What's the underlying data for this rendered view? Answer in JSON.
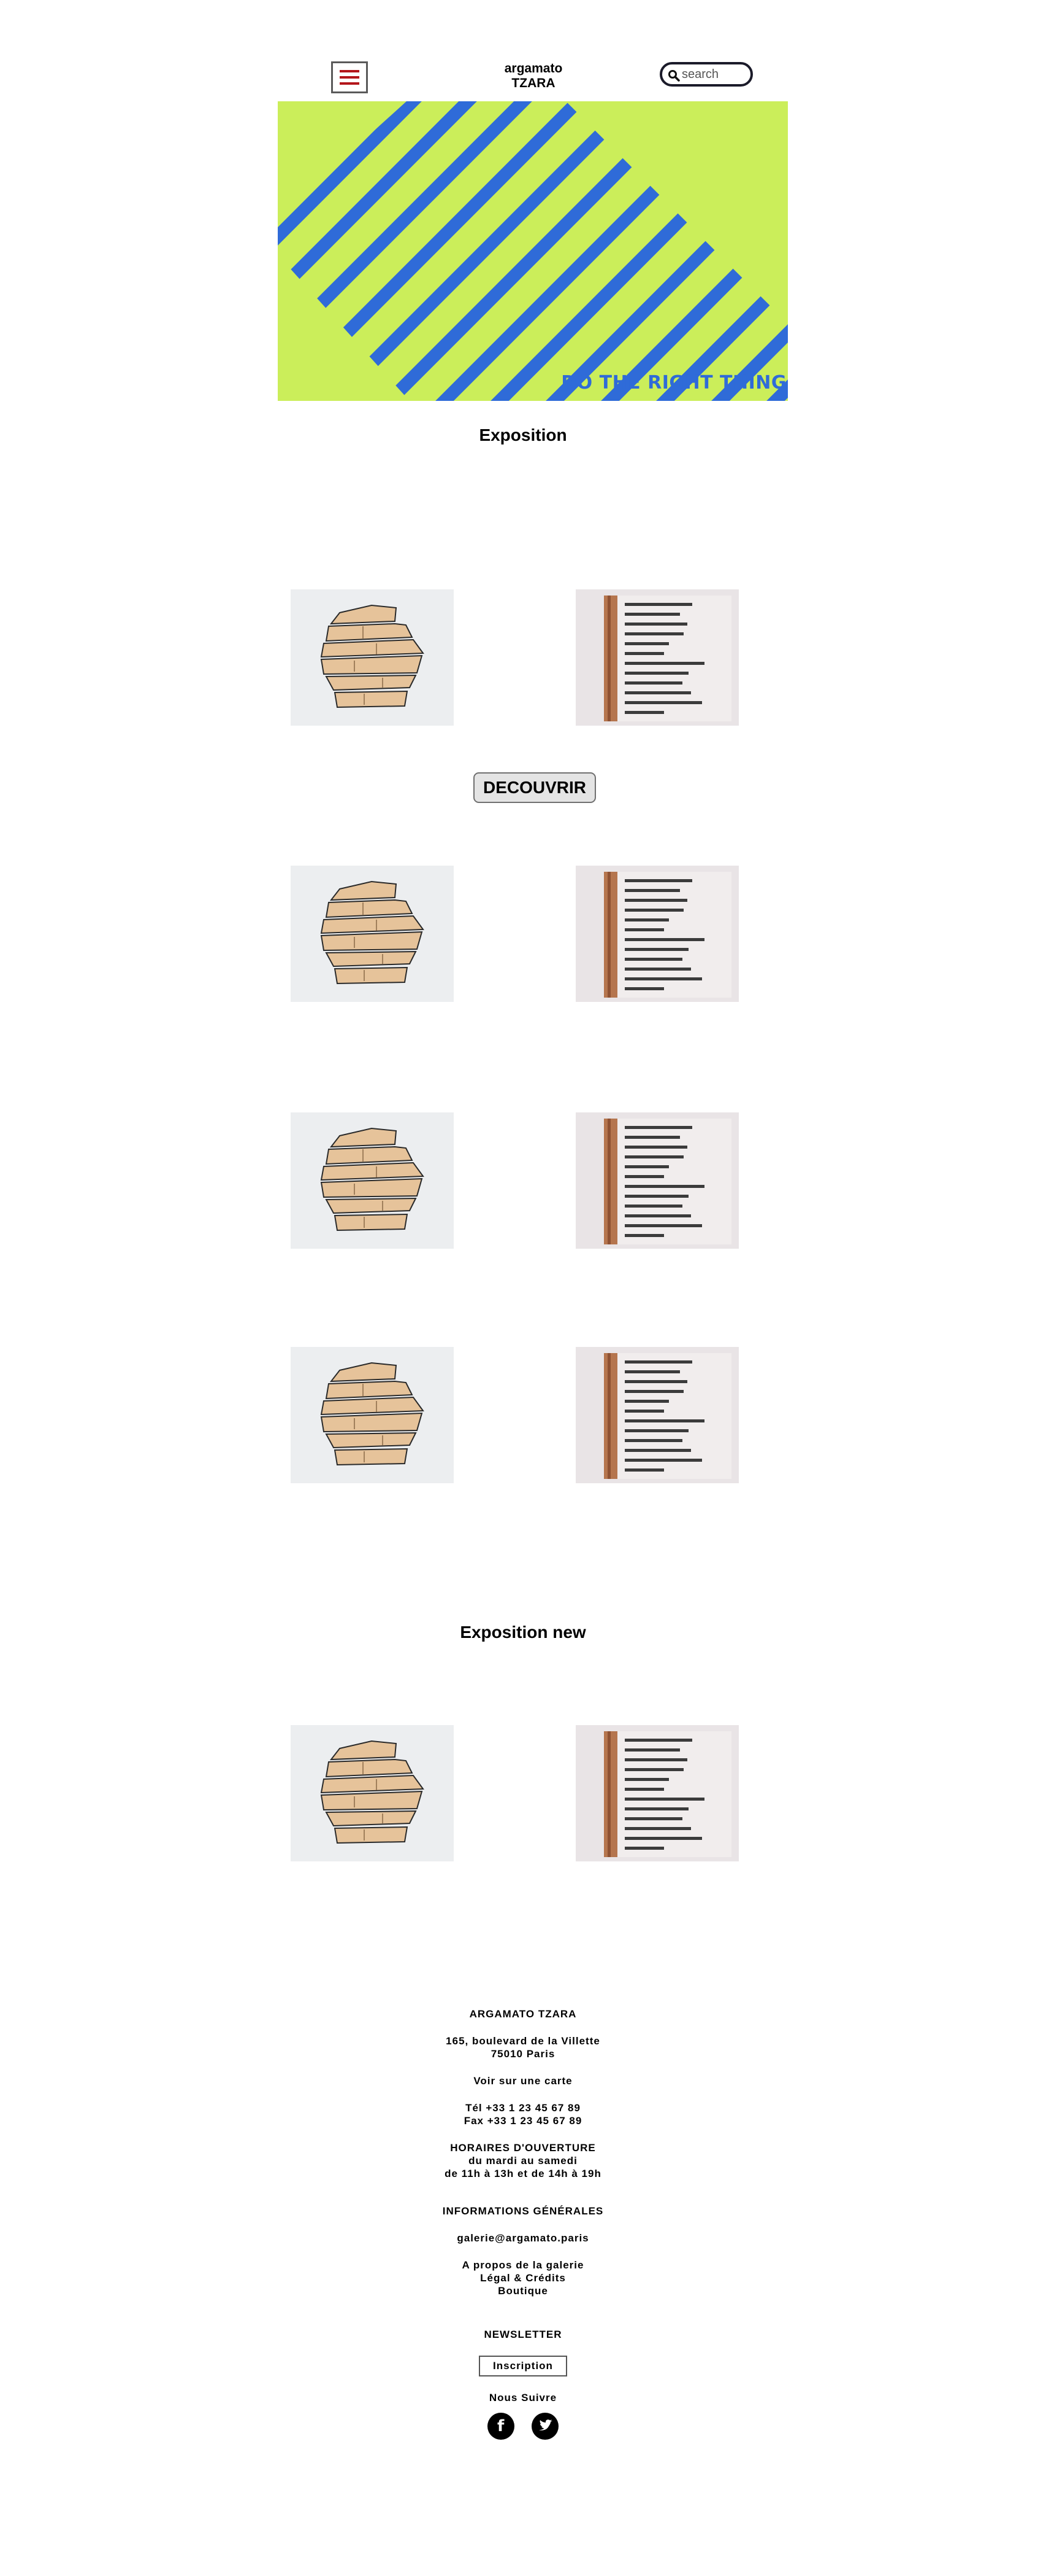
{
  "header": {
    "brand_line1": "argamato",
    "brand_line2": "TZARA",
    "search_placeholder": "search",
    "menu_icon": "hamburger-icon",
    "search_icon": "search-icon"
  },
  "hero": {
    "caption": "DO THE RIGHT THING",
    "colors": {
      "background": "#cbee5a",
      "stripes": "#2f6bd8"
    }
  },
  "sections": [
    {
      "title": "Exposition",
      "button_label": "DECOUVRIR"
    },
    {
      "title": "Exposition new"
    }
  ],
  "footer": {
    "gallery_name": "ARGAMATO TZARA",
    "address_line1": "165, boulevard de la Villette",
    "address_line2": "75010 Paris",
    "map_link": "Voir sur une carte",
    "tel": "Tél +33 1 23 45 67 89",
    "fax": "Fax +33 1 23 45 67 89",
    "hours_title": "HORAIRES D'OUVERTURE",
    "hours_days": "du mardi au samedi",
    "hours_times": "de 11h à 13h et de 14h à 19h",
    "info_title": "INFORMATIONS GÉNÉRALES",
    "email": "galerie@argamato.paris",
    "links": [
      "A propos de la galerie",
      "Légal & Crédits",
      "Boutique"
    ],
    "newsletter_title": "NEWSLETTER",
    "newsletter_button": "Inscription",
    "follow_title": "Nous Suivre",
    "social": [
      "facebook-icon",
      "twitter-icon"
    ]
  }
}
